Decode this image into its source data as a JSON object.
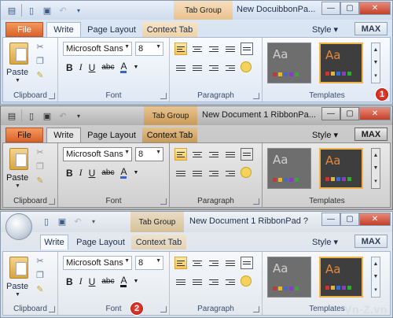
{
  "colors": {
    "accent_orange": "#d9612a",
    "tab_group": "#e9c28e",
    "close_red": "#c2402a",
    "marker_red": "#d62a1c"
  },
  "windows": [
    {
      "id": "w1",
      "title": "New DocuibbonPa...",
      "tab_group": "Tab Group",
      "tabs": {
        "file": "File",
        "write": "Write",
        "page_layout": "Page Layout",
        "context_tab": "Context Tab"
      },
      "style_label": "Style",
      "max_label": "MAX",
      "font": {
        "name": "Microsoft Sans",
        "size": "8"
      },
      "groups": {
        "clipboard": "Clipboard",
        "font": "Font",
        "paragraph": "Paragraph",
        "templates": "Templates"
      },
      "paste_label": "Paste",
      "marker": "1"
    },
    {
      "id": "w2",
      "title": "New Document 1 RibbonPa...",
      "tab_group": "Tab Group",
      "tabs": {
        "file": "File",
        "write": "Write",
        "page_layout": "Page Layout",
        "context_tab": "Context Tab"
      },
      "style_label": "Style",
      "max_label": "MAX",
      "font": {
        "name": "Microsoft Sans",
        "size": "8"
      },
      "groups": {
        "clipboard": "Clipboard",
        "font": "Font",
        "paragraph": "Paragraph",
        "templates": "Templates"
      },
      "paste_label": "Paste"
    },
    {
      "id": "w3",
      "title": "New Document 1 RibbonPad ?",
      "tab_group": "Tab Group",
      "tabs": {
        "write": "Write",
        "page_layout": "Page Layout",
        "context_tab": "Context Tab"
      },
      "style_label": "Style",
      "max_label": "MAX",
      "font": {
        "name": "Microsoft Sans",
        "size": "8"
      },
      "groups": {
        "clipboard": "Clipboard",
        "font": "Font",
        "paragraph": "Paragraph",
        "templates": "Templates"
      },
      "paste_label": "Paste",
      "marker": "2"
    }
  ],
  "format_buttons": {
    "bold": "B",
    "italic": "I",
    "underline": "U",
    "strike": "abc",
    "font_color": "A"
  },
  "template_thumb": "Aa",
  "watermark": "Vn-Z.vn"
}
